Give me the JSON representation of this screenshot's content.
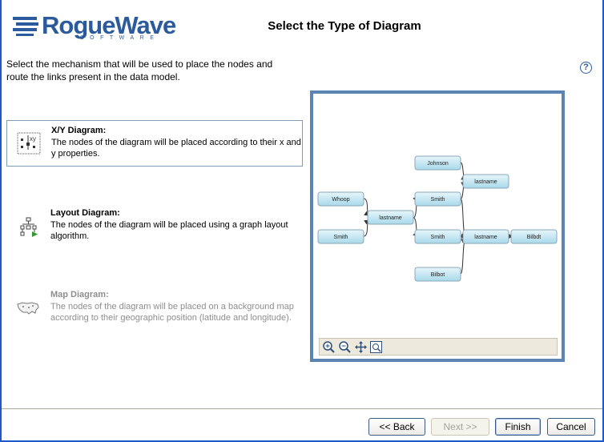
{
  "header": {
    "brand_name": "RogueWave",
    "brand_sub": "SOFTWARE",
    "title": "Select the Type of Diagram"
  },
  "intro": "Select the mechanism that will be used to place the nodes and route the links present in the data model.",
  "help_label": "?",
  "options": [
    {
      "title": "X/Y Diagram:",
      "description": "The nodes of the diagram will be placed according to their x and y properties.",
      "icon": "xy-diagram-icon",
      "selected": true,
      "enabled": true
    },
    {
      "title": "Layout Diagram:",
      "description": "The nodes of the diagram will be placed using a graph layout algorithm.",
      "icon": "layout-diagram-icon",
      "selected": false,
      "enabled": true
    },
    {
      "title": "Map Diagram:",
      "description": "The nodes of the diagram will be placed on a background map according to their geographic position (latitude and longitude).",
      "icon": "map-diagram-icon",
      "selected": false,
      "enabled": false
    }
  ],
  "preview": {
    "nodes": [
      "Whoop",
      "Smith",
      "lastname",
      "Johnson",
      "Smith",
      "lastname",
      "Smith",
      "lastname",
      "Bilbdt",
      "Bilbot"
    ],
    "toolbar_icons": [
      "zoom-in-icon",
      "zoom-out-icon",
      "pan-icon",
      "fit-view-icon"
    ]
  },
  "buttons": {
    "back": "<< Back",
    "next": "Next >>",
    "finish": "Finish",
    "cancel": "Cancel"
  },
  "colors": {
    "brand": "#2b5b9c",
    "node_fill": "#bfe4f0",
    "preview_border": "#5b84b3"
  }
}
